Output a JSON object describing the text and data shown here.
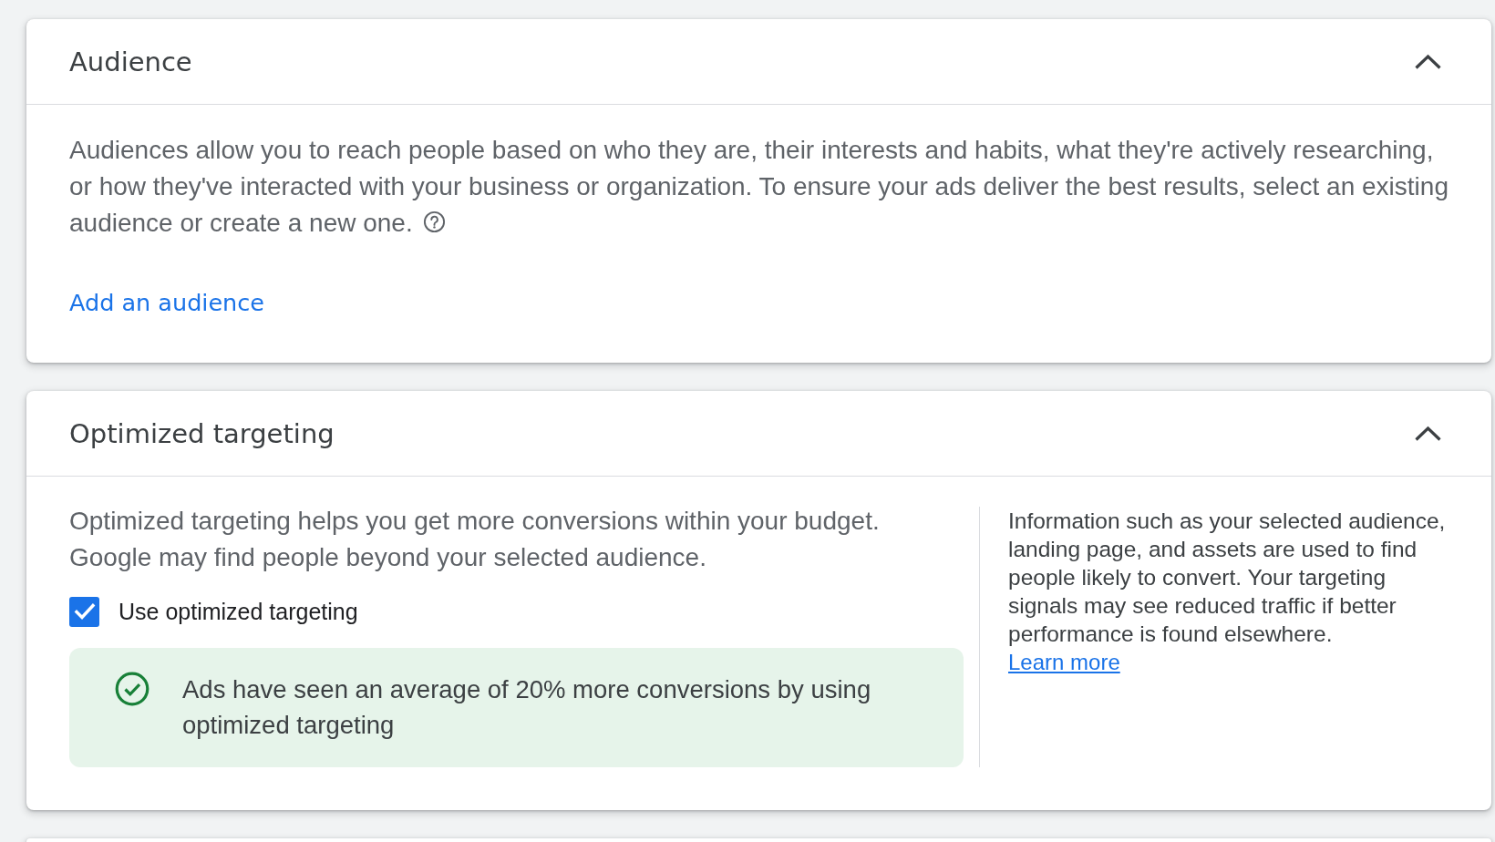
{
  "sections": [
    {
      "kind": "audience",
      "title": "Audience",
      "expanded": true,
      "description": "Audiences allow you to reach people based on who they are, their interests and habits, what they're actively researching, or how they've interacted with your business or organization. To ensure your ads deliver the best results, select an existing audience or create a new one.",
      "link": "Add an audience"
    },
    {
      "kind": "optimized_targeting",
      "title": "Optimized targeting",
      "expanded": true,
      "description": "Optimized targeting helps you get more conversions within your budget. Google may find people beyond your selected audience.",
      "checkbox": {
        "label": "Use optimized targeting",
        "checked": true
      },
      "notice": "Ads have seen an average of 20% more conversions by using optimized targeting",
      "side_note": {
        "text": "Information such as your selected audience, landing page, and assets are used to find people likely to convert. Your targeting signals may see reduced traffic if better performance is found elsewhere.",
        "link": "Learn more"
      }
    }
  ]
}
